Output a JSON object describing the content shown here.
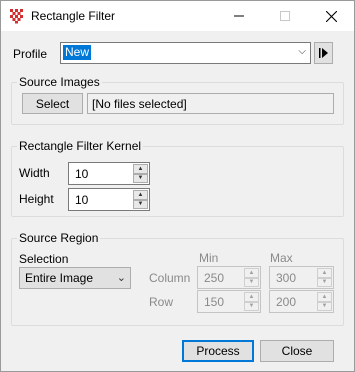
{
  "window": {
    "title": "Rectangle Filter",
    "icons": {
      "app": "grid-app-icon",
      "minimize": "minimize-icon",
      "maximize": "maximize-icon",
      "close": "close-icon"
    }
  },
  "profile": {
    "label": "Profile",
    "value": "New",
    "go_icon": "play-end-icon"
  },
  "source_images": {
    "title": "Source Images",
    "select_label": "Select",
    "files_text": "[No files selected]"
  },
  "kernel": {
    "title": "Rectangle Filter Kernel",
    "width_label": "Width",
    "width_value": "10",
    "height_label": "Height",
    "height_value": "10"
  },
  "region": {
    "title": "Source Region",
    "selection_label": "Selection",
    "selection_value": "Entire Image",
    "min_label": "Min",
    "max_label": "Max",
    "column_label": "Column",
    "column_min": "250",
    "column_max": "300",
    "row_label": "Row",
    "row_min": "150",
    "row_max": "200"
  },
  "actions": {
    "process_label": "Process",
    "close_label": "Close"
  },
  "colors": {
    "accent": "#0078d7",
    "icon_red": "#d32f2f"
  }
}
